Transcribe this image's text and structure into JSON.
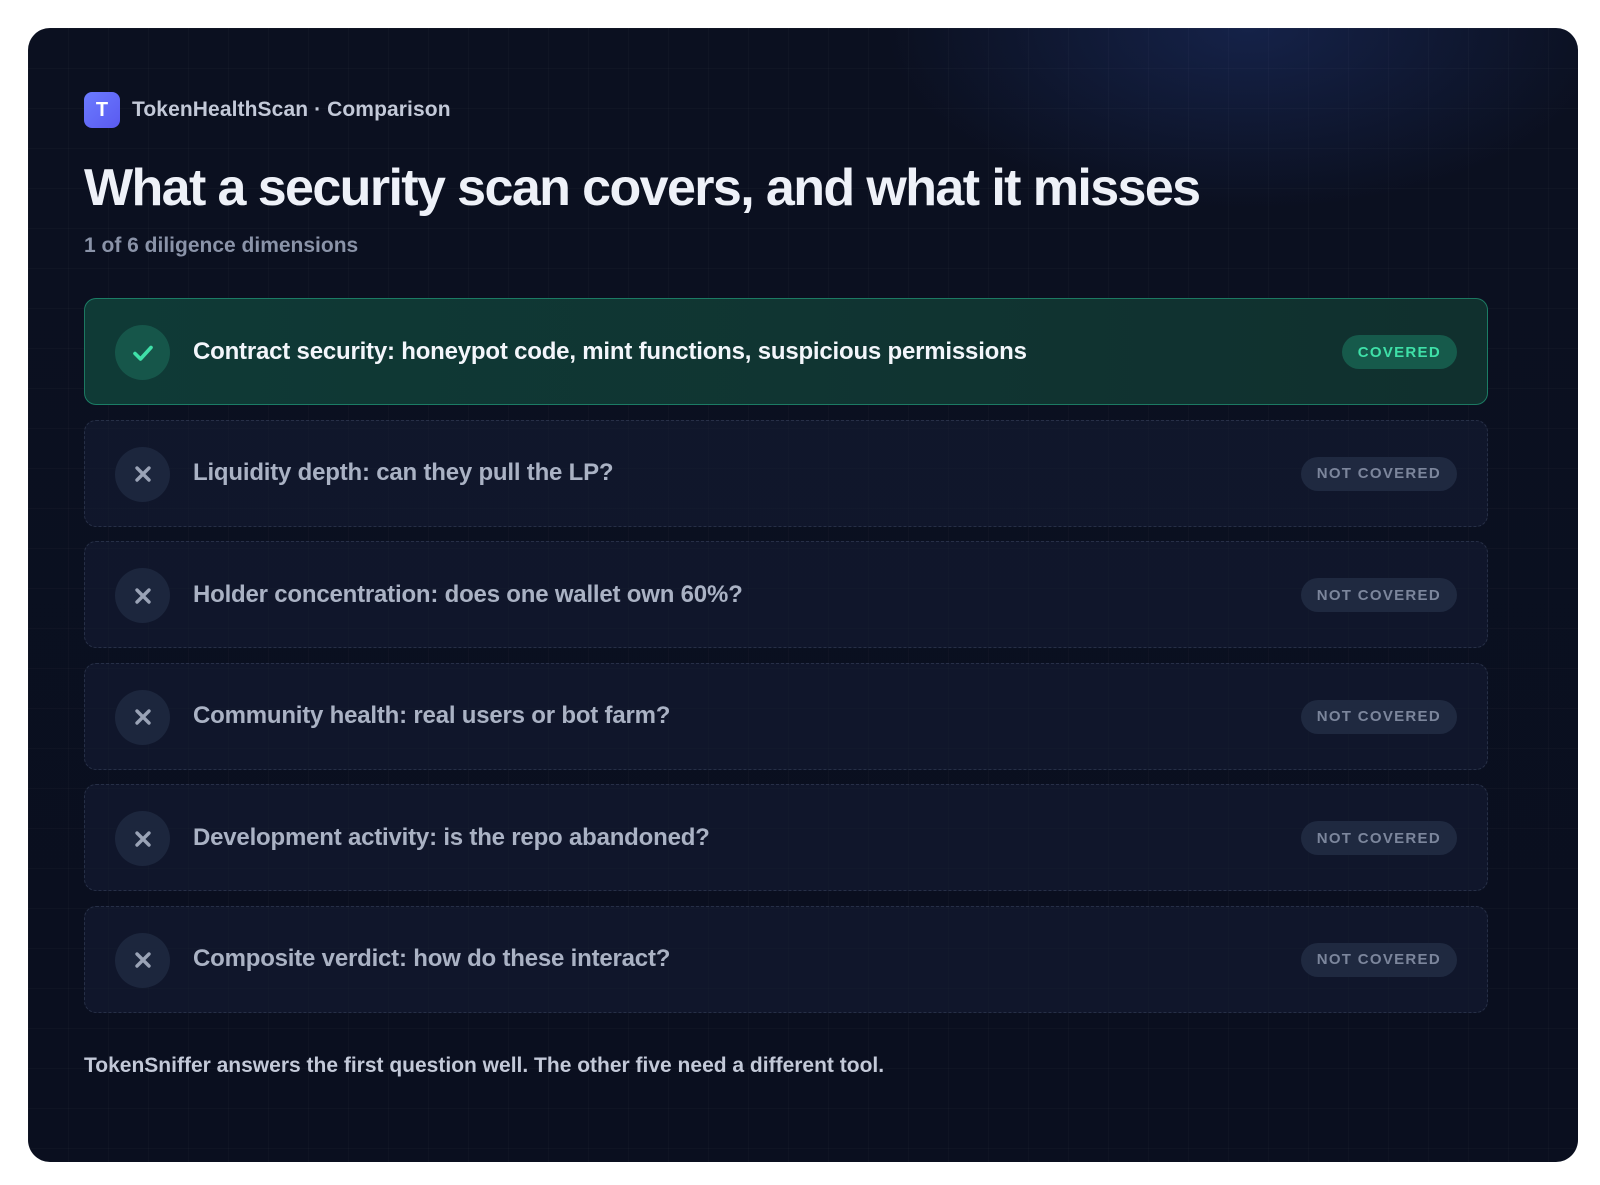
{
  "brand": {
    "logo_letter": "T",
    "label": "TokenHealthScan · Comparison"
  },
  "title": "What a security scan covers, and what it misses",
  "subtitle": "1 of 6 diligence dimensions",
  "rows": [
    {
      "text": "Contract security: honeypot code, mint functions, suspicious permissions",
      "status": "COVERED",
      "icon": "check-icon"
    },
    {
      "text": "Liquidity depth: can they pull the LP?",
      "status": "NOT COVERED",
      "icon": "x-icon"
    },
    {
      "text": "Holder concentration: does one wallet own 60%?",
      "status": "NOT COVERED",
      "icon": "x-icon"
    },
    {
      "text": "Community health: real users or bot farm?",
      "status": "NOT COVERED",
      "icon": "x-icon"
    },
    {
      "text": "Development activity: is the repo abandoned?",
      "status": "NOT COVERED",
      "icon": "x-icon"
    },
    {
      "text": "Composite verdict: how do these interact?",
      "status": "NOT COVERED",
      "icon": "x-icon"
    }
  ],
  "footer": "TokenSniffer answers the first question well. The other five need a different tool.",
  "colors": {
    "covered_accent": "#3fe0a8",
    "not_covered_text": "#7c869c",
    "background": "#0b1020"
  }
}
